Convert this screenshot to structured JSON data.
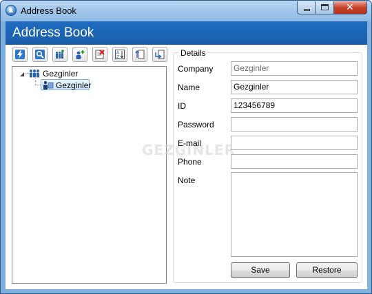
{
  "window": {
    "title": "Address Book",
    "minimize_icon": "minimize-icon",
    "maximize_icon": "maximize-icon",
    "close_glyph": "✕"
  },
  "header": {
    "title": "Address Book"
  },
  "toolbar": {
    "buttons": [
      {
        "name": "connect-button",
        "icon": "lightning-icon"
      },
      {
        "name": "search-button",
        "icon": "magnifier-icon"
      },
      {
        "name": "add-group-button",
        "icon": "add-group-icon"
      },
      {
        "name": "add-user-button",
        "icon": "add-user-icon"
      },
      {
        "name": "delete-button",
        "icon": "delete-icon"
      },
      {
        "name": "sort-button",
        "icon": "sort-az-icon"
      },
      {
        "name": "import-button",
        "icon": "import-icon"
      },
      {
        "name": "export-button",
        "icon": "export-icon"
      }
    ]
  },
  "tree": {
    "group": {
      "label": "Gezginler",
      "expanded": true
    },
    "children": [
      {
        "label": "Gezginler",
        "selected": true
      }
    ]
  },
  "details": {
    "legend": "Details",
    "company": {
      "label": "Company",
      "value": "Gezginler"
    },
    "name": {
      "label": "Name",
      "value": "Gezginler"
    },
    "id": {
      "label": "ID",
      "value": "123456789"
    },
    "password": {
      "label": "Password",
      "value": ""
    },
    "email": {
      "label": "E-mail",
      "value": ""
    },
    "phone": {
      "label": "Phone",
      "value": ""
    },
    "note": {
      "label": "Note",
      "value": ""
    }
  },
  "actions": {
    "save_label": "Save",
    "restore_label": "Restore"
  },
  "watermark": "GEZGINLER",
  "colors": {
    "header": "#1a5ea9",
    "titlebar": "#a2c6ea",
    "close": "#c7432b"
  }
}
